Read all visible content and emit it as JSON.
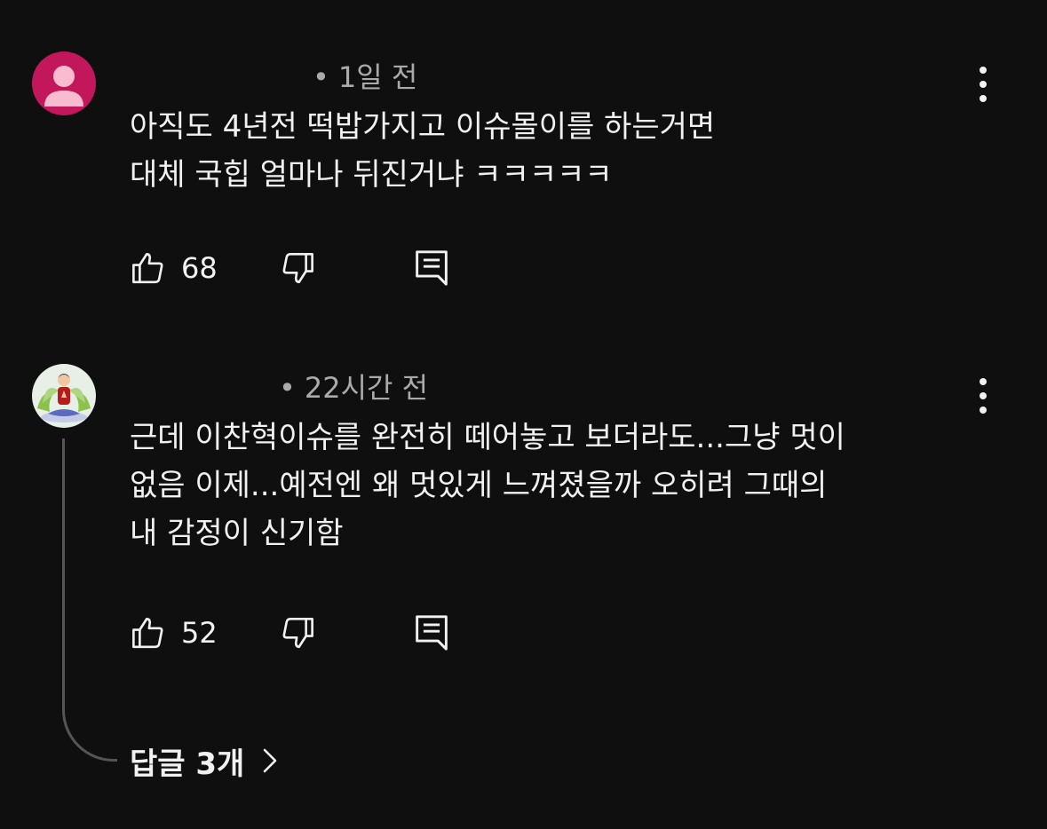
{
  "comments": [
    {
      "author": "",
      "time": "1일 전",
      "lines": [
        "아직도 4년전 떡밥가지고 이슈몰이를 하는거면",
        "대체 국힙 얼마나 뒤진거냐 ㅋㅋㅋㅋㅋ"
      ],
      "likes": "68",
      "avatar_color": "#c2185b"
    },
    {
      "author": "",
      "time": "22시간 전",
      "lines": [
        "근데 이찬혁이슈를 완전히 떼어놓고 보더라도...그냥 멋이",
        "없음 이제...예전엔 왜 멋있게 느껴졌을까 오히려 그때의",
        "내 감정이 신기함"
      ],
      "likes": "52",
      "avatar_color": "#e8efe6"
    }
  ],
  "replies": {
    "label": "답글 3개",
    "chevron_icon": "chevron-right-icon"
  },
  "icons": [
    "person-icon",
    "like-icon",
    "dislike-icon",
    "reply-icon",
    "more-vert-icon"
  ],
  "colors": {
    "background": "#0f0f0f",
    "text": "#f1f1f1",
    "secondary": "#aaaaaa",
    "thread_line": "#555555"
  }
}
